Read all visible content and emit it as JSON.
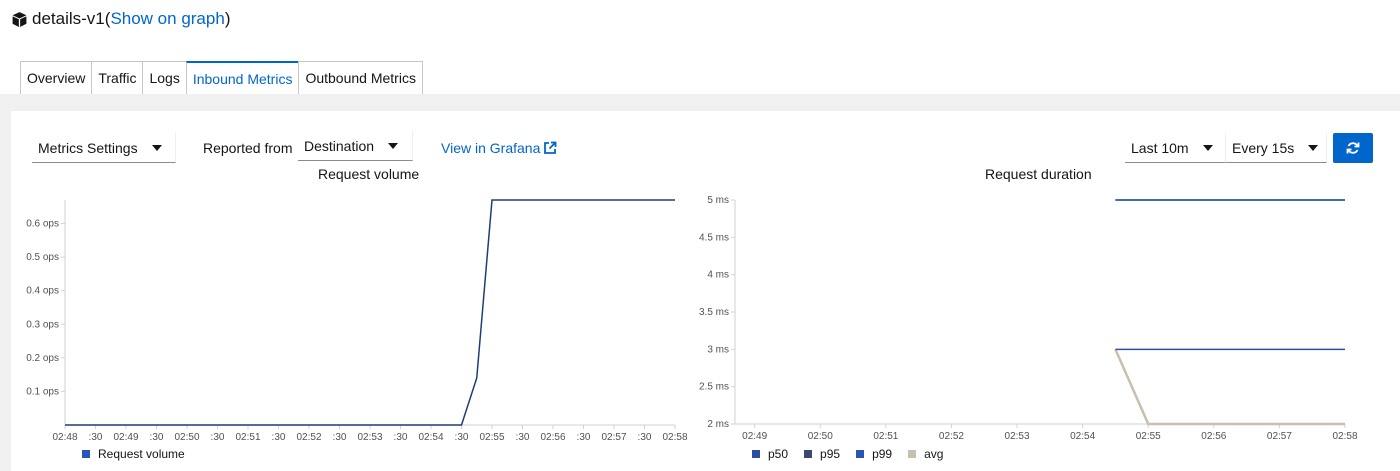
{
  "header": {
    "title": "details-v1",
    "open_paren": " (",
    "graph_link": "Show on graph",
    "close_paren": ")"
  },
  "tabs": [
    {
      "label": "Overview"
    },
    {
      "label": "Traffic"
    },
    {
      "label": "Logs"
    },
    {
      "label": "Inbound Metrics",
      "active": true
    },
    {
      "label": "Outbound Metrics"
    }
  ],
  "toolbar": {
    "metrics_settings": "Metrics Settings",
    "reported_from_label": "Reported from",
    "reported_from_value": "Destination",
    "grafana_link": "View in Grafana",
    "time_range": "Last 10m",
    "refresh_interval": "Every 15s"
  },
  "colors": {
    "accent": "#0066cc",
    "line_dark": "#1f3d7a",
    "p50": "#2c4fa0",
    "p95": "#3b4a6b",
    "p99": "#2b55b3",
    "avg": "#c9bfae"
  },
  "chart_data": [
    {
      "type": "line",
      "title": "Request volume",
      "x": [
        "02:48",
        "02:54:30",
        "02:54:45",
        "02:55",
        "02:58"
      ],
      "xticks": [
        "02:48",
        ":30",
        "02:49",
        ":30",
        "02:50",
        ":30",
        "02:51",
        ":30",
        "02:52",
        ":30",
        "02:53",
        ":30",
        "02:54",
        ":30",
        "02:55",
        ":30",
        "02:56",
        ":30",
        "02:57",
        ":30",
        "02:58"
      ],
      "yticks": [
        "0.1 ops",
        "0.2 ops",
        "0.3 ops",
        "0.4 ops",
        "0.5 ops",
        "0.6 ops"
      ],
      "ylim": [
        0,
        0.67
      ],
      "series": [
        {
          "name": "Request volume",
          "values": [
            0,
            0,
            0.14,
            0.67,
            0.67
          ]
        }
      ]
    },
    {
      "type": "line",
      "title": "Request duration",
      "x": [
        "02:54:30",
        "02:55",
        "02:58"
      ],
      "xticks": [
        "02:49",
        "02:50",
        "02:51",
        "02:52",
        "02:53",
        "02:54",
        "02:55",
        "02:56",
        "02:57",
        "02:58"
      ],
      "yticks": [
        "2 ms",
        "2.5 ms",
        "3 ms",
        "3.5 ms",
        "4 ms",
        "4.5 ms",
        "5 ms"
      ],
      "ylim": [
        2,
        5
      ],
      "series": [
        {
          "name": "p50",
          "values": [
            3,
            3,
            3
          ]
        },
        {
          "name": "p95",
          "values": [
            5,
            5,
            5
          ]
        },
        {
          "name": "p99",
          "values": [
            5,
            5,
            5
          ]
        },
        {
          "name": "avg",
          "values": [
            3,
            2,
            2
          ]
        }
      ]
    }
  ]
}
